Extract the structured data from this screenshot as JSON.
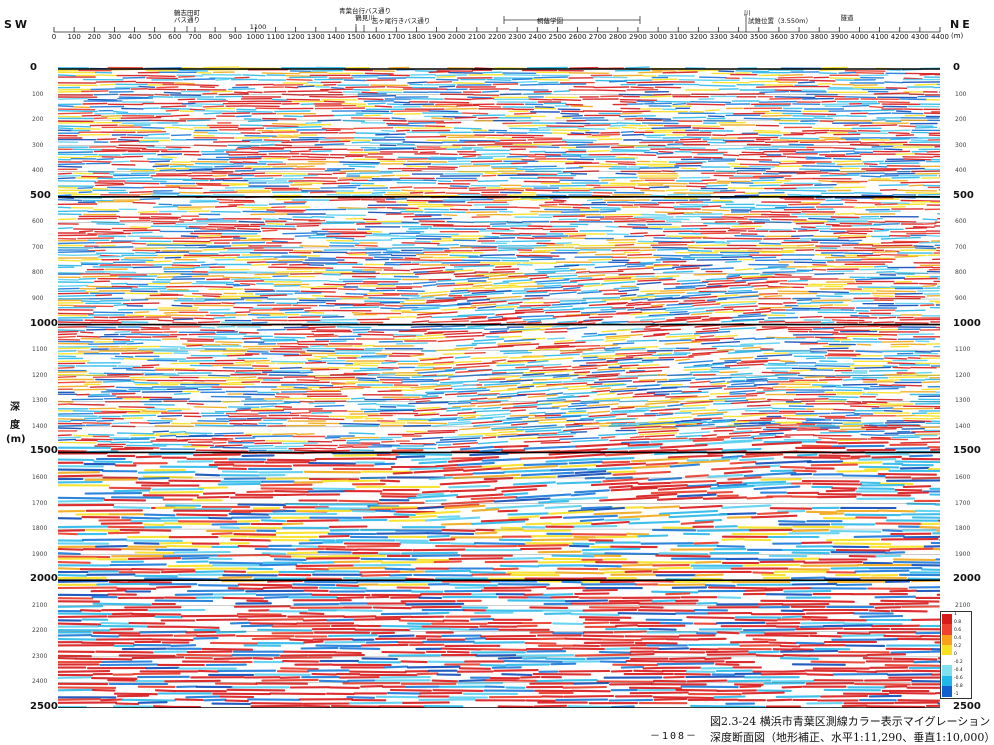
{
  "direction": {
    "left": "SW",
    "right": "NE"
  },
  "distance_unit": "(m)",
  "distance_ticks": [
    "0",
    "100",
    "200",
    "300",
    "400",
    "500",
    "600",
    "700",
    "800",
    "900",
    "1000",
    "1100",
    "1200",
    "1300",
    "1400",
    "1500",
    "1600",
    "1700",
    "1800",
    "1900",
    "2000",
    "2100",
    "2200",
    "2300",
    "2400",
    "2500",
    "2600",
    "2700",
    "2800",
    "2900",
    "3000",
    "3100",
    "3200",
    "3300",
    "3400",
    "3500",
    "3600",
    "3700",
    "3800",
    "3900",
    "4000",
    "4100",
    "4200",
    "4300",
    "4400"
  ],
  "header_annotations": [
    {
      "text": "鶴志田町\nバス通り"
    },
    {
      "text": "1100"
    },
    {
      "text": "青葉台行バス通り\n鶴見川"
    },
    {
      "text": "志ヶ尾行きバス通り"
    },
    {
      "text": "川"
    },
    {
      "text": "試錐位置（3.550m）"
    },
    {
      "text": "隧道"
    },
    {
      "text": "桐蔭学園"
    }
  ],
  "depth_axis": {
    "title_chars": [
      "深",
      "度",
      "(m)"
    ],
    "major_ticks": [
      "0",
      "500",
      "1000",
      "1500",
      "2000",
      "2500"
    ],
    "minor_ticks": [
      "100",
      "200",
      "300",
      "400",
      "600",
      "700",
      "800",
      "900",
      "1100",
      "1200",
      "1300",
      "1400",
      "1600",
      "1700",
      "1800",
      "1900",
      "2100",
      "2200",
      "2300",
      "2400"
    ]
  },
  "legend": {
    "colors": [
      "#d81a1a",
      "#f04030",
      "#f8a018",
      "#f8e020",
      "#ffffff",
      "#80e0f0",
      "#20b8e8",
      "#1060d0"
    ],
    "labels": [
      "1",
      "0.8",
      "0.6",
      "0.4",
      "0.2",
      "0",
      "-0.2",
      "-0.4",
      "-0.6",
      "-0.8",
      "-1"
    ]
  },
  "caption": {
    "line1": "図2.3-24 横浜市青葉区測線カラー表示マイグレーション",
    "line2": "深度断面図（地形補正、水平1:11,290、垂直1:10,000）"
  },
  "page_number": "－108－"
}
